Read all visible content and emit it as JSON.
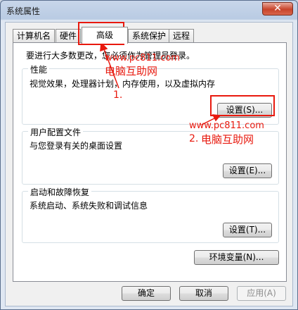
{
  "window": {
    "title": "系统属性",
    "close_glyph": "✕"
  },
  "tabs": [
    {
      "label": "计算机名"
    },
    {
      "label": "硬件"
    },
    {
      "label": "高级"
    },
    {
      "label": "系统保护"
    },
    {
      "label": "远程"
    }
  ],
  "active_tab": "高级",
  "notice": "要进行大多数更改，您必须作为管理员登录。",
  "performance": {
    "title": "性能",
    "desc": "视觉效果，处理器计划，内存使用，以及虚拟内存",
    "button": "设置(S)..."
  },
  "profile": {
    "title": "用户配置文件",
    "desc": "与您登录有关的桌面设置",
    "button": "设置(E)..."
  },
  "startup": {
    "title": "启动和故障恢复",
    "desc": "系统启动、系统失败和调试信息",
    "button": "设置(T)..."
  },
  "env_button": "环境变量(N)...",
  "footer": {
    "ok": "确定",
    "cancel": "取消",
    "apply": "应用(A)"
  },
  "annotations": {
    "url1": "www.pc811.com",
    "site1": "电脑互助网",
    "step1": "1.",
    "url2": "www.pc811.com",
    "step2": "2.",
    "site2": "电脑互助网"
  },
  "colors": {
    "annotation": "#e8190e",
    "titlebar": "#b9cbe3"
  }
}
